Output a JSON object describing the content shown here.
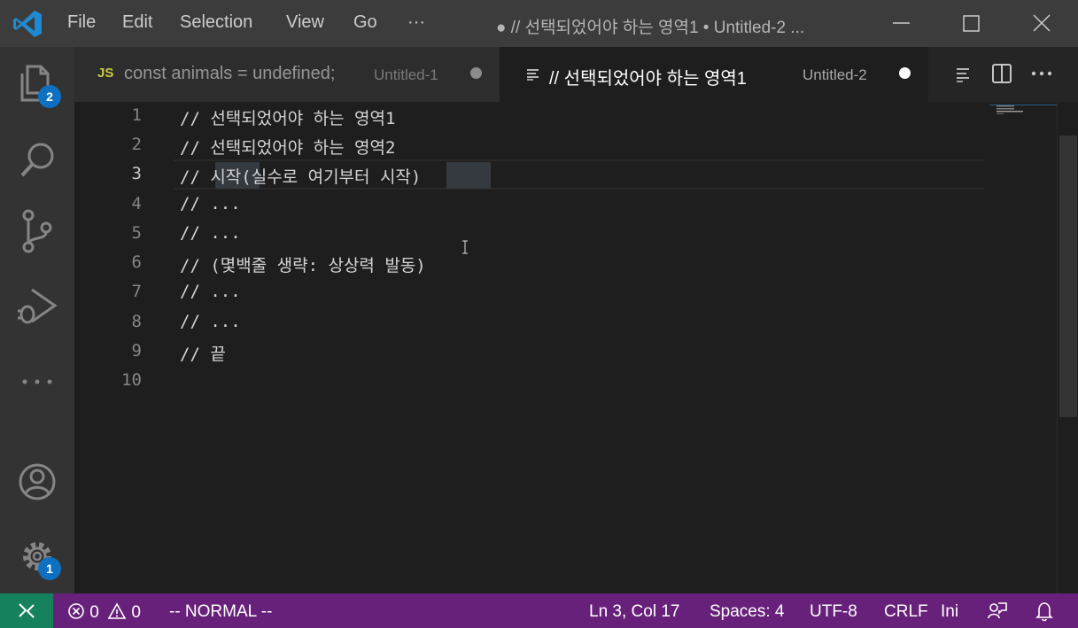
{
  "titlebar": {
    "menu": [
      "File",
      "Edit",
      "Selection",
      "View",
      "Go",
      "···"
    ],
    "window_title": "● // 선택되었어야 하는 영역1 • Untitled-2 ..."
  },
  "activitybar": {
    "explorer_badge": "2",
    "settings_badge": "1"
  },
  "tabs": [
    {
      "lang_icon": "JS",
      "label": "const animals = undefined;",
      "description": "Untitled-1",
      "dirty": true,
      "active": false
    },
    {
      "label": "// 선택되었어야 하는 영역1",
      "description": "Untitled-2",
      "dirty": true,
      "active": true
    }
  ],
  "editor": {
    "line_numbers": [
      "1",
      "2",
      "3",
      "4",
      "5",
      "6",
      "7",
      "8",
      "9",
      "10"
    ],
    "active_line": 3,
    "lines": [
      "// 선택되었어야 하는 영역1",
      "// 선택되었어야 하는 영역2",
      "// 시작(실수로 여기부터 시작)",
      "// ...",
      "// ...",
      "// (몇백줄 생략: 상상력 발동)",
      "// ...",
      "// ...",
      "// 끝",
      ""
    ]
  },
  "statusbar": {
    "errors": "0",
    "warnings": "0",
    "vim_mode": "-- NORMAL --",
    "cursor_position": "Ln 3, Col 17",
    "indentation": "Spaces: 4",
    "encoding": "UTF-8",
    "eol": "CRLF",
    "language": "Ini"
  },
  "colors": {
    "statusbar_bg": "#68217a",
    "remote_bg": "#16825d",
    "badge_bg": "#0e70c0",
    "titlebar_bg": "#3c3c3c",
    "editor_bg": "#1e1e1e"
  }
}
